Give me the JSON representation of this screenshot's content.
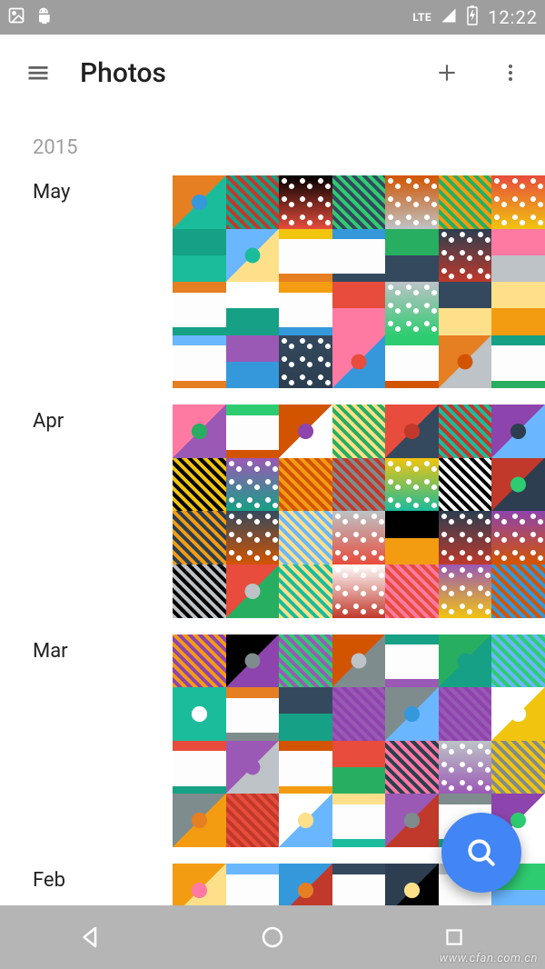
{
  "status": {
    "network_label": "LTE",
    "clock": "12:22"
  },
  "app_bar": {
    "title": "Photos"
  },
  "year": "2015",
  "months": {
    "may": {
      "label": "May",
      "count": 28
    },
    "apr": {
      "label": "Apr",
      "count": 28
    },
    "mar": {
      "label": "Mar",
      "count": 28
    },
    "feb": {
      "label": "Feb",
      "count": 7
    }
  },
  "icons": {
    "menu": "menu-icon",
    "add": "plus-icon",
    "overflow": "overflow-icon",
    "search": "search-icon",
    "back": "nav-back-icon",
    "home": "nav-home-icon",
    "recent": "nav-recent-icon",
    "picture": "picture-icon",
    "android": "android-icon",
    "signal": "signal-icon",
    "battery": "battery-icon"
  },
  "colors": {
    "fab": "#4285f4",
    "status_bg": "#9e9e9e",
    "muted_text": "#9e9e9e",
    "text": "#212121"
  },
  "watermark": "www.cfan.com.cn"
}
